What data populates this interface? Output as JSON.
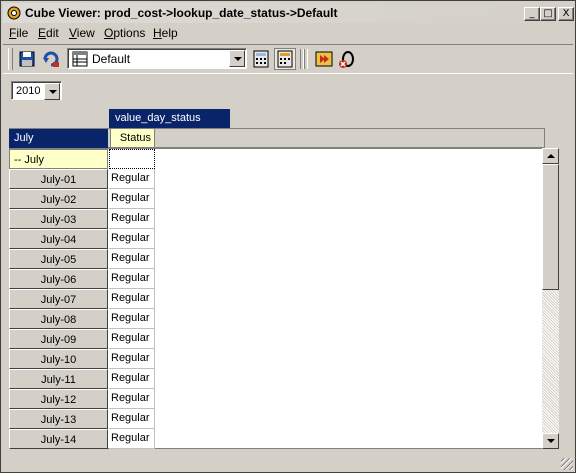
{
  "window": {
    "title": "Cube Viewer: prod_cost->lookup_date_status->Default"
  },
  "caption_buttons": {
    "minimize": "_",
    "maximize": "□",
    "close": "X"
  },
  "menu": [
    {
      "label": "File"
    },
    {
      "label": "Edit"
    },
    {
      "label": "View"
    },
    {
      "label": "Options"
    },
    {
      "label": "Help"
    }
  ],
  "toolbar": {
    "view_name": "Default"
  },
  "title_dimension": {
    "selected": "2010"
  },
  "grid": {
    "column_dimension": "value_day_status",
    "row_dimension": "July",
    "column_header": "Status",
    "consolidation_row": "-- July",
    "rows": [
      {
        "label": "July-01",
        "value": "Regular"
      },
      {
        "label": "July-02",
        "value": "Regular"
      },
      {
        "label": "July-03",
        "value": "Regular"
      },
      {
        "label": "July-04",
        "value": "Regular"
      },
      {
        "label": "July-05",
        "value": "Regular"
      },
      {
        "label": "July-06",
        "value": "Regular"
      },
      {
        "label": "July-07",
        "value": "Regular"
      },
      {
        "label": "July-08",
        "value": "Regular"
      },
      {
        "label": "July-09",
        "value": "Regular"
      },
      {
        "label": "July-10",
        "value": "Regular"
      },
      {
        "label": "July-11",
        "value": "Regular"
      },
      {
        "label": "July-12",
        "value": "Regular"
      },
      {
        "label": "July-13",
        "value": "Regular"
      },
      {
        "label": "July-14",
        "value": "Regular"
      }
    ]
  },
  "colors": {
    "header_blue": "#0a246a",
    "highlight_yellow": "#ffffc8",
    "face": "#d4d0c8"
  }
}
